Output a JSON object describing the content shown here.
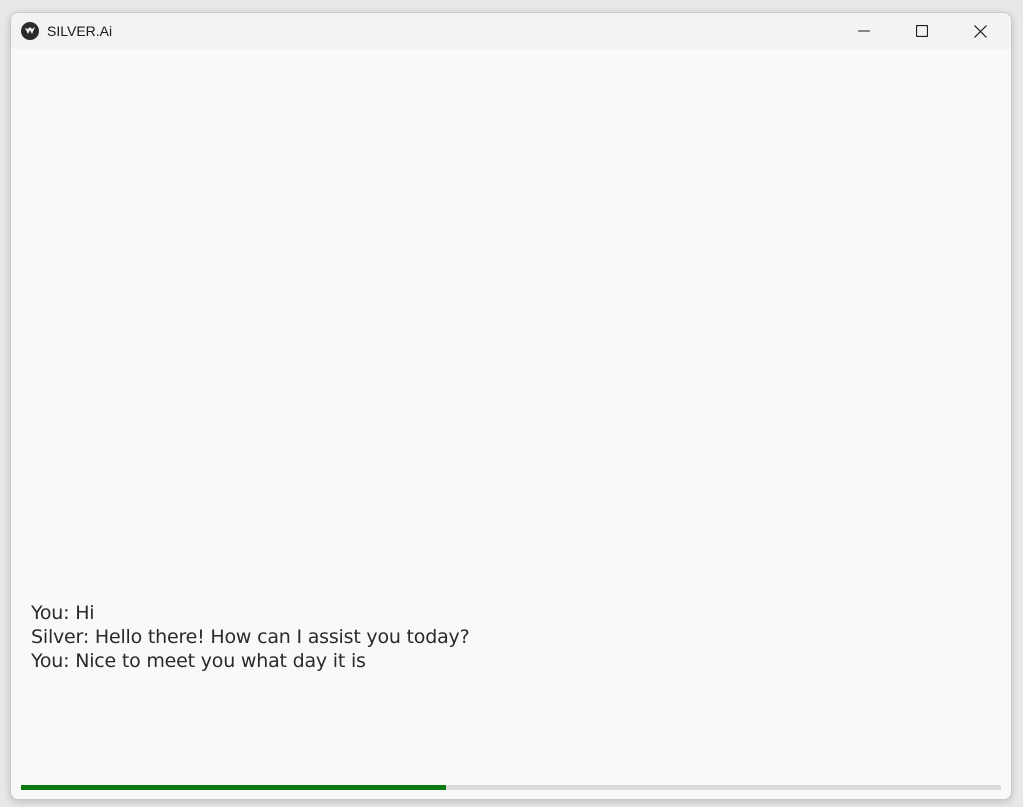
{
  "window": {
    "title": "SILVER.Ai",
    "icon": "kivy-logo-icon"
  },
  "caption_buttons": {
    "minimize_icon": "minimize-icon",
    "maximize_icon": "maximize-icon",
    "close_icon": "close-icon"
  },
  "chat": {
    "messages": [
      "You: Hi",
      "Silver: Hello there! How can I assist you today?",
      "You: Nice to meet you what day it is"
    ]
  },
  "progress": {
    "fraction": 0.434,
    "fill_color": "#0a7a10",
    "track_color": "#dcdcdc"
  }
}
